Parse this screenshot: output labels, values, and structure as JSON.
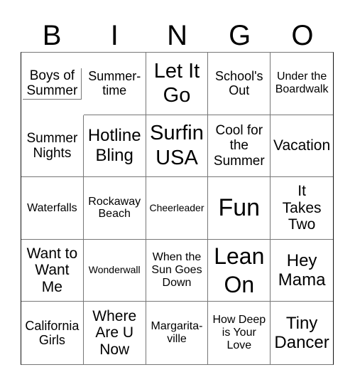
{
  "header": [
    "B",
    "I",
    "N",
    "G",
    "O"
  ],
  "cells": [
    "Boys of Summer",
    "Summer-time",
    "Let It Go",
    "School's Out",
    "Under the Boardwalk",
    "Summer Nights",
    "Hotline Bling",
    "Surfin USA",
    "Cool for the Summer",
    "Vacation",
    "Waterfalls",
    "Rockaway Beach",
    "Cheerleader",
    "Fun",
    "It Takes Two",
    "Want to Want Me",
    "Wonderwall",
    "When the Sun Goes Down",
    "Lean On",
    "Hey Mama",
    "California Girls",
    "Where Are U Now",
    "Margarita-ville",
    "How Deep is Your Love",
    "Tiny Dancer"
  ]
}
